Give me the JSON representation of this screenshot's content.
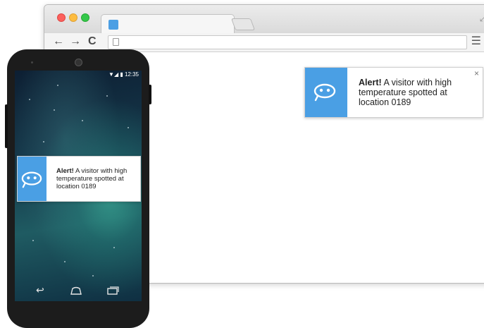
{
  "browser": {
    "window_controls": [
      "close",
      "minimize",
      "maximize"
    ],
    "icons": {
      "back": "arrow-left",
      "forward": "arrow-right",
      "reload": "reload",
      "menu": "hamburger",
      "fullscreen": "expand-arrows",
      "page": "blank-page"
    },
    "address_bar": {
      "value": ""
    }
  },
  "desktop_notification": {
    "title": "Alert!",
    "message": "A visitor with high temperature spotted at location 0189",
    "close_glyph": "×",
    "icon": "face-icon",
    "accent_color": "#4a9fe4"
  },
  "phone": {
    "status_time": "12:35",
    "notification": {
      "title": "Alert!",
      "message": "A visitor with high temperature spotted at location 0189",
      "icon": "face-icon"
    },
    "nav_buttons": [
      "back",
      "home",
      "recent-apps"
    ]
  }
}
